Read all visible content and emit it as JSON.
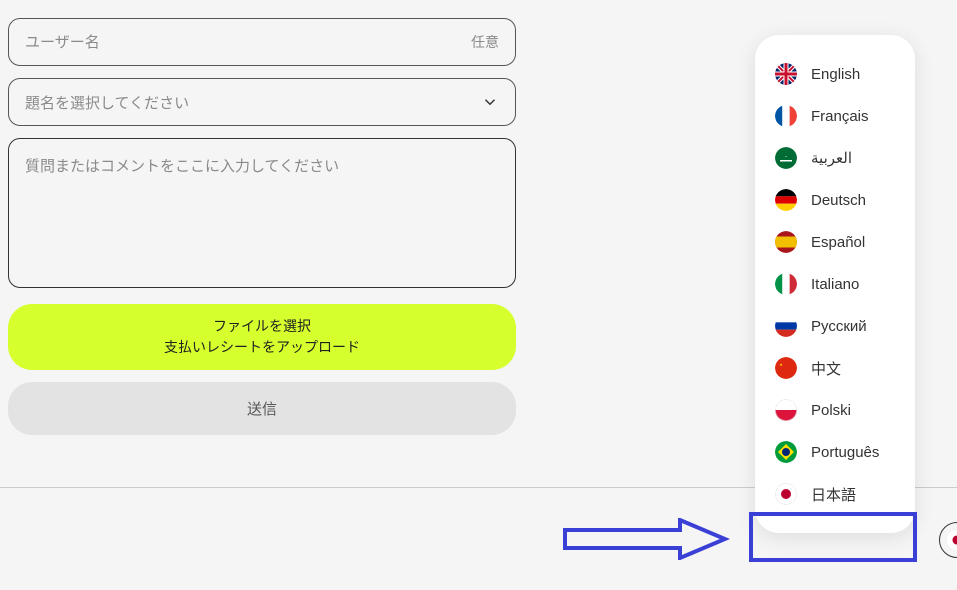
{
  "form": {
    "username_placeholder": "ユーザー名",
    "username_hint": "任意",
    "subject_placeholder": "題名を選択してください",
    "comment_placeholder": "質問またはコメントをここに入力してください",
    "upload_line1": "ファイルを選択",
    "upload_line2": "支払いレシートをアップロード",
    "submit_label": "送信"
  },
  "languages": [
    {
      "label": "English",
      "code": "en"
    },
    {
      "label": "Français",
      "code": "fr"
    },
    {
      "label": "العربية",
      "code": "ar"
    },
    {
      "label": "Deutsch",
      "code": "de"
    },
    {
      "label": "Español",
      "code": "es"
    },
    {
      "label": "Italiano",
      "code": "it"
    },
    {
      "label": "Русский",
      "code": "ru"
    },
    {
      "label": "中文",
      "code": "zh"
    },
    {
      "label": "Polski",
      "code": "pl"
    },
    {
      "label": "Português",
      "code": "pt"
    },
    {
      "label": "日本語",
      "code": "ja"
    }
  ]
}
